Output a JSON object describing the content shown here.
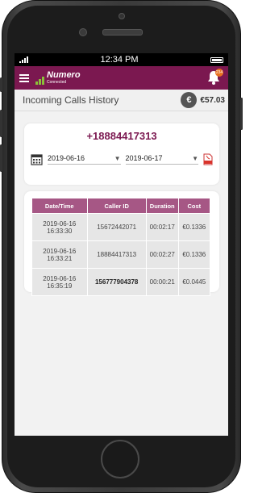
{
  "status_bar": {
    "time": "12:34 PM"
  },
  "app_bar": {
    "logo_name": "Numero",
    "logo_status": "Connected",
    "notification_count": "234"
  },
  "header": {
    "title": "Incoming Calls History",
    "balance": "€57.03",
    "coin_symbol": "€"
  },
  "filter": {
    "phone_number": "+18884417313",
    "date_from": "2019-06-16",
    "date_to": "2019-06-17"
  },
  "table": {
    "headers": [
      "Date/Time",
      "Caller ID",
      "Duration",
      "Cost"
    ],
    "rows": [
      {
        "date": "2019-06-16",
        "time": "16:33:30",
        "caller": "15672442071",
        "duration": "00:02:17",
        "cost": "€0.1336"
      },
      {
        "date": "2019-06-16",
        "time": "16:33:21",
        "caller": "18884417313",
        "duration": "00:02:27",
        "cost": "€0.1336"
      },
      {
        "date": "2019-06-16",
        "time": "16:35:19",
        "caller": "156777904378",
        "duration": "00:00:21",
        "cost": "€0.0445"
      }
    ]
  }
}
